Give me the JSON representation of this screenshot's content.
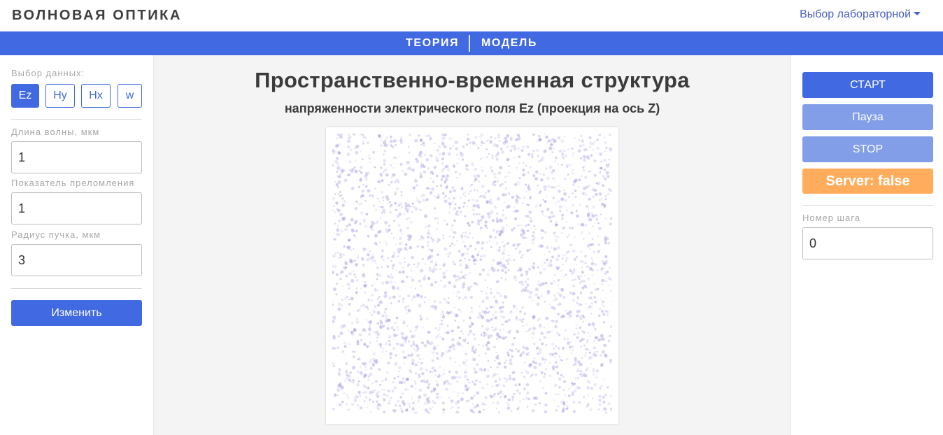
{
  "header": {
    "brand": "ВОЛНОВАЯ ОПТИКА",
    "lab_select": "Выбор лабораторной"
  },
  "nav": {
    "tabs": [
      {
        "label": "ТЕОРИЯ"
      },
      {
        "label": "МОДЕЛЬ"
      }
    ]
  },
  "left": {
    "data_select_label": "Выбор данных:",
    "data_buttons": [
      {
        "label": "Ez",
        "active": true
      },
      {
        "label": "Hy",
        "active": false
      },
      {
        "label": "Hx",
        "active": false
      },
      {
        "label": "w",
        "active": false
      }
    ],
    "wavelength": {
      "label": "Длина волны, мкм",
      "value": "1"
    },
    "refraction": {
      "label": "Показатель преломления",
      "value": "1"
    },
    "radius": {
      "label": "Радиус пучка, мкм",
      "value": "3"
    },
    "change_button": "Изменить"
  },
  "center": {
    "title": "Пространственно-временная структура",
    "subtitle": "напряженности электрического поля Ez (проекция на ось Z)"
  },
  "right": {
    "start_button": "СТАРТ",
    "pause_button": "Пауза",
    "stop_button": "STOP",
    "server_status": "Server: false",
    "step_label": "Номер шага",
    "step_value": "0"
  },
  "colors": {
    "accent": "#4169e1",
    "accent_disabled": "#829ee9",
    "server_badge": "#ffad5c",
    "field_dots": "#8a7fd6"
  }
}
